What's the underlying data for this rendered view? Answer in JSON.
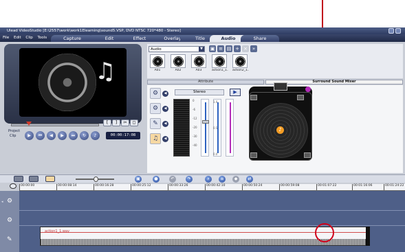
{
  "window": {
    "title": "Ulead VideoStudio [E:\\2557\\work\\work1Elearning\\sound5.VSP, DVD NTSC 720*480 - Stereo]"
  },
  "menu": [
    "File",
    "Edit",
    "Clip",
    "Tools"
  ],
  "steps": [
    {
      "label": "Capture",
      "active": false
    },
    {
      "label": "Edit",
      "active": false
    },
    {
      "label": "Effect",
      "active": false
    },
    {
      "label": "Overlay",
      "active": false
    },
    {
      "label": "Title",
      "active": false
    },
    {
      "label": "Audio",
      "active": true
    },
    {
      "label": "Share",
      "active": false
    }
  ],
  "preview": {
    "project_label": "Project",
    "clip_label": "Clip",
    "timecode": "00:00:17:08"
  },
  "library": {
    "category": "Audio",
    "thumbnails": [
      "A01",
      "A02",
      "A03",
      "action1_1...",
      "action2_1..."
    ]
  },
  "attribute": {
    "header": "Attribute",
    "channel_mode": "Stereo",
    "scale_labels": [
      "0",
      "-6",
      "-12",
      "-20",
      "-30",
      "-40"
    ],
    "fader_top": "1.0",
    "fader_mid": "0.5",
    "fader_low": "0.0"
  },
  "mixer": {
    "header": "Surround Sound Mixer"
  },
  "timeline": {
    "ruler": [
      "00:00:00",
      "00:00:08:14",
      "00:00:16:28",
      "00:00:25:12",
      "00:00:33:26",
      "00:00:42:10",
      "00:00:50:24",
      "00:00:59:08",
      "00:01:07:22",
      "00:01:16:06",
      "00:01:24:22"
    ],
    "clip_name": "action1_1.wav"
  },
  "colors": {
    "annotation": "#d0021b",
    "track_bg": "#4e5f88",
    "active_step": "#e6e9f0"
  }
}
